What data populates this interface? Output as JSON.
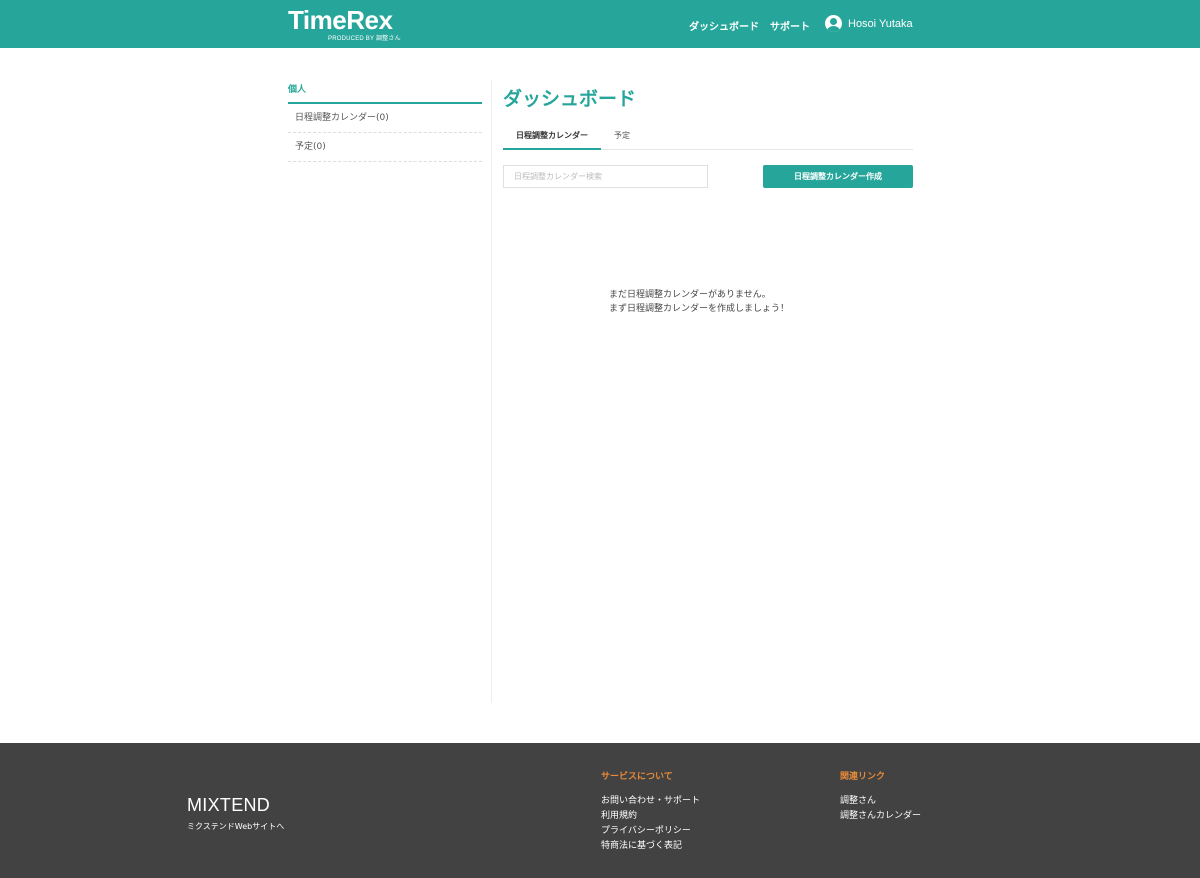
{
  "header": {
    "logo_text": "TimeRex",
    "logo_sub": "PRODUCED BY 調整さん",
    "nav": {
      "dashboard": "ダッシュボード",
      "support": "サポート",
      "user_name": "Hosoi Yutaka"
    }
  },
  "sidebar": {
    "title": "個人",
    "items": [
      {
        "label": "日程調整カレンダー(0)"
      },
      {
        "label": "予定(0)"
      }
    ]
  },
  "main": {
    "title": "ダッシュボード",
    "tabs": [
      {
        "label": "日程調整カレンダー",
        "active": true
      },
      {
        "label": "予定",
        "active": false
      }
    ],
    "search": {
      "placeholder": "日程調整カレンダー検索",
      "value": ""
    },
    "create_button": "日程調整カレンダー作成",
    "empty_line1": "まだ日程調整カレンダーがありません。",
    "empty_line2": "まず日程調整カレンダーを作成しましょう！"
  },
  "footer": {
    "logo": "MIXTEND",
    "website_link": "ミクステンドWebサイトへ",
    "service": {
      "heading": "サービスについて",
      "links": [
        "お問い合わせ・サポート",
        "利用規約",
        "プライバシーポリシー",
        "特商法に基づく表記"
      ]
    },
    "related": {
      "heading": "関連リンク",
      "links": [
        "調整さん",
        "調整さんカレンダー"
      ]
    }
  },
  "colors": {
    "accent": "#26a69a",
    "footer_bg": "#424242",
    "footer_heading": "#e5893a"
  }
}
